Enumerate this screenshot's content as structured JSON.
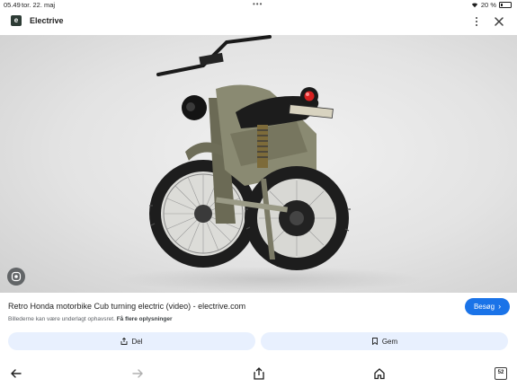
{
  "status_bar": {
    "time": "05.49",
    "date": "tor. 22. maj",
    "battery": "20 %"
  },
  "header": {
    "logo_letter": "e",
    "site_name": "Electrive"
  },
  "image": {
    "subject": "retro electric motorcycle"
  },
  "caption": {
    "title": "Retro Honda motorbike Cub turning electric (video) - electrive.com",
    "copyright_notice": "Billederne kan være underlagt ophavsret.",
    "learn_more": "Få flere oplysninger",
    "visit_label": "Besøg"
  },
  "actions": {
    "share_label": "Del",
    "save_label": "Gem"
  },
  "bottom_nav": {
    "tab_count": "52"
  },
  "colors": {
    "accent": "#1a73e8",
    "pill_bg": "#e8f0fe"
  }
}
